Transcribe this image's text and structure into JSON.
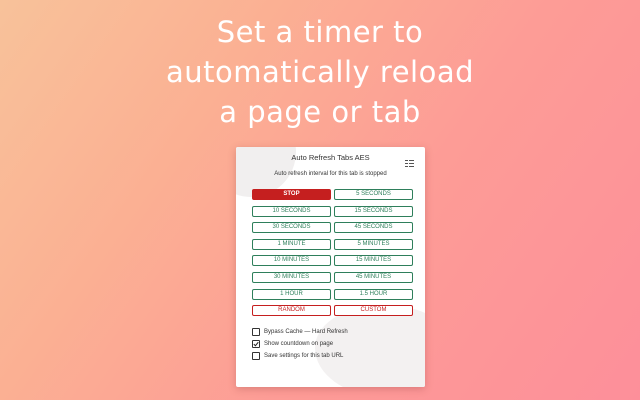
{
  "headline": {
    "line1": "Set a timer to",
    "line2": "automatically reload",
    "line3": "a page or tab"
  },
  "popup": {
    "title": "Auto Refresh Tabs AES",
    "menu_icon": "menu-icon",
    "status": "Auto refresh interval for this tab is stopped",
    "buttons": {
      "stop": "STOP",
      "s5": "5 SECONDS",
      "s10": "10 SECONDS",
      "s15": "15 SECONDS",
      "s30": "30 SECONDS",
      "s45": "45 SECONDS",
      "m1": "1 MINUTE",
      "m5": "5 MINUTES",
      "m10": "10 MINUTES",
      "m15": "15 MINUTES",
      "m30": "30 MINUTES",
      "m45": "45 MINUTES",
      "h1": "1 HOUR",
      "h15": "1.5 HOUR",
      "random": "RANDOM",
      "custom": "CUSTOM"
    },
    "options": {
      "bypass_cache": {
        "label": "Bypass Cache — Hard Refresh",
        "checked": false
      },
      "show_countdown": {
        "label": "Show countdown on page",
        "checked": true
      },
      "save_settings": {
        "label": "Save settings for this tab URL",
        "checked": false
      }
    }
  },
  "colors": {
    "accent_green": "#2e7f5b",
    "stop_red": "#c51f1f"
  }
}
